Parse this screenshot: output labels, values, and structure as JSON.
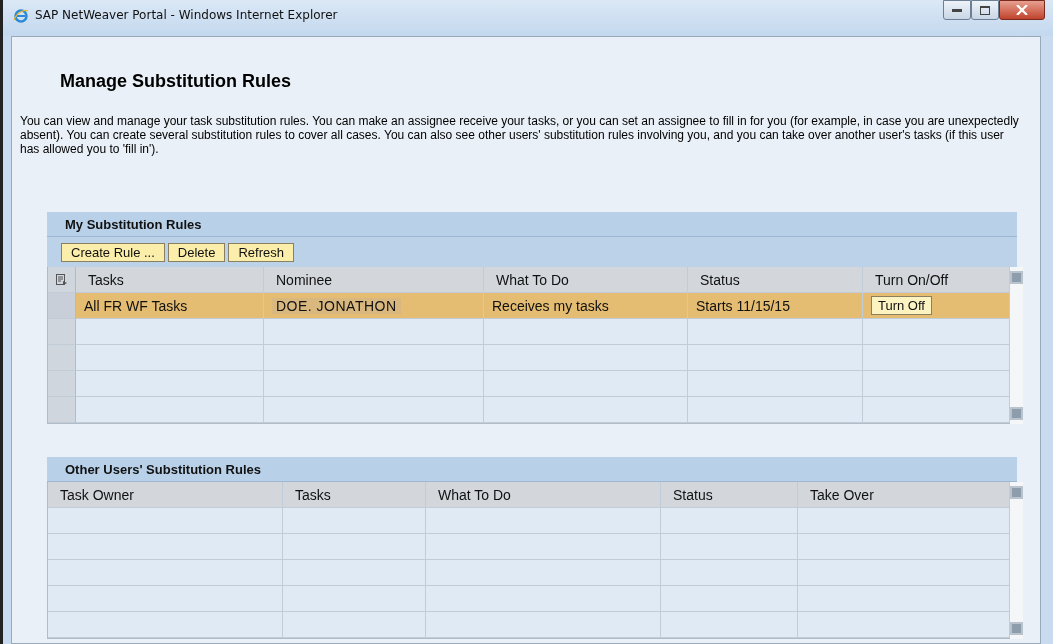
{
  "window": {
    "title": "SAP NetWeaver Portal - Windows Internet Explorer"
  },
  "page": {
    "title": "Manage Substitution Rules",
    "description": "You can view and manage your task substitution rules. You can make an assignee receive your tasks, or you can set an assignee to fill in for you (for example, in case you are unexpectedly absent). You can create several substitution rules to cover all cases. You can also see other users' substitution rules involving you, and you can take over another user's tasks (if this user has allowed you to 'fill in')."
  },
  "my_rules": {
    "title": "My Substitution Rules",
    "buttons": [
      "Create Rule ...",
      "Delete",
      "Refresh"
    ],
    "columns": [
      "Tasks",
      "Nominee",
      "What To Do",
      "Status",
      "Turn On/Off"
    ],
    "rows": [
      {
        "selected": true,
        "tasks": "All FR WF Tasks",
        "nominee": "DOE. JONATHON",
        "what_to_do": "Receives my tasks",
        "status": "Starts 11/15/15",
        "toggle": "Turn Off"
      }
    ]
  },
  "other_rules": {
    "title": "Other Users' Substitution Rules",
    "columns": [
      "Task Owner",
      "Tasks",
      "What To Do",
      "Status",
      "Take Over"
    ]
  }
}
